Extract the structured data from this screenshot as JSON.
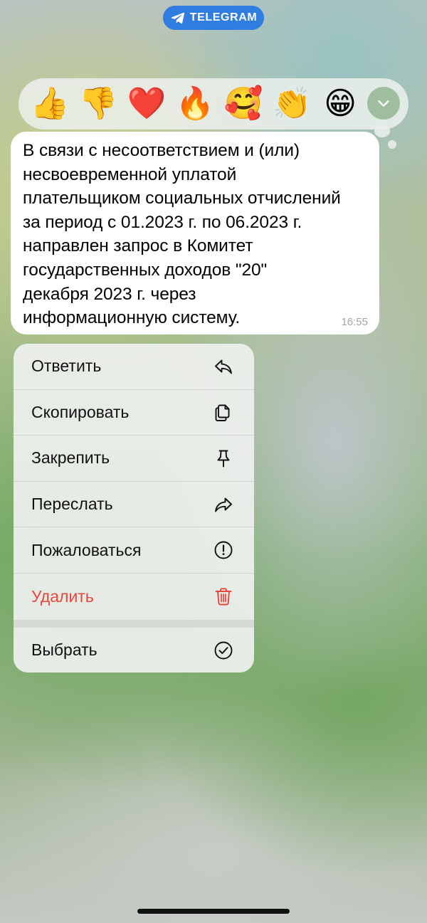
{
  "header": {
    "app_name": "TELEGRAM"
  },
  "reactions": [
    {
      "name": "thumbs-up-icon",
      "emoji": "👍"
    },
    {
      "name": "thumbs-down-icon",
      "emoji": "👎"
    },
    {
      "name": "red-heart-icon",
      "emoji": "❤️"
    },
    {
      "name": "fire-icon",
      "emoji": "🔥"
    },
    {
      "name": "smiling-face-with-hearts-icon",
      "emoji": "🥰"
    },
    {
      "name": "clapping-hands-icon",
      "emoji": "👏"
    },
    {
      "name": "grinning-face-icon",
      "emoji": "😁"
    }
  ],
  "message": {
    "lines": [
      "В связи с несоответствием и (или)",
      "несвоевременной уплатой",
      "плательщиком социальных отчислений",
      "за период с 01.2023 г. по 06.2023 г.",
      "направлен запрос в Комитет",
      "государственных доходов \"20\"",
      "декабря 2023 г. через",
      "информационную систему."
    ],
    "time": "16:55"
  },
  "menu": {
    "items": [
      {
        "label": "Ответить",
        "icon": "reply-icon"
      },
      {
        "label": "Скопировать",
        "icon": "copy-icon"
      },
      {
        "label": "Закрепить",
        "icon": "pin-icon"
      },
      {
        "label": "Переслать",
        "icon": "forward-icon"
      },
      {
        "label": "Пожаловаться",
        "icon": "report-icon"
      },
      {
        "label": "Удалить",
        "icon": "trash-icon"
      }
    ],
    "select": {
      "label": "Выбрать",
      "icon": "select-check-icon"
    }
  },
  "colors": {
    "accent": "#2f7de1",
    "danger": "#e5473c",
    "timestamp": "#a4a4a4"
  }
}
